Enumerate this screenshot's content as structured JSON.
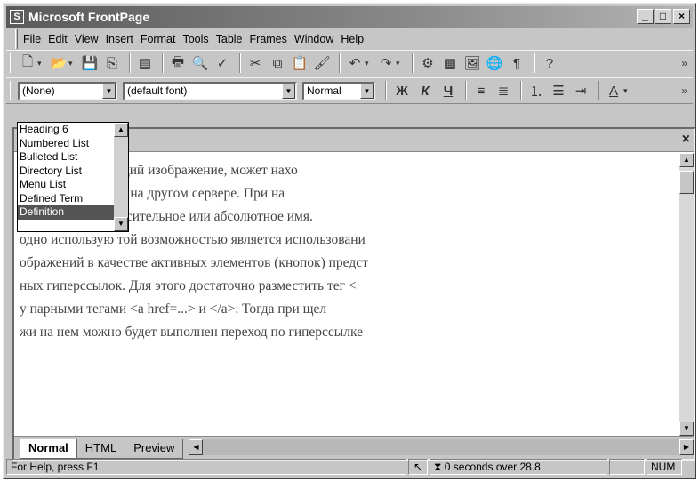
{
  "titlebar": {
    "app_icon": "S",
    "title": "Microsoft FrontPage"
  },
  "menubar": {
    "items": [
      "File",
      "Edit",
      "View",
      "Insert",
      "Format",
      "Tools",
      "Table",
      "Frames",
      "Window",
      "Help"
    ]
  },
  "format_bar": {
    "style_value": "(None)",
    "font_value": "(default font)",
    "size_value": "Normal",
    "bold": "Ж",
    "italic": "К",
    "underline": "Ч"
  },
  "style_dropdown": {
    "options": [
      "Heading 6",
      "Numbered List",
      "Bulleted List",
      "Directory List",
      "Menu List",
      "Defined Term",
      "Definition"
    ],
    "selected_index": 6
  },
  "document": {
    "lines": [
      "е. Файл, содержащий изображение, может нахо",
      "каталоге или даже на другом сервере. При на",
      "ачего полное относительное или абсолютное имя.",
      "одно использую той возможностью является использовани",
      "ображений в качестве активных элементов (кнопок) предст",
      "ных гиперссылок. Для этого достаточно разместить тег <",
      "у парными тегами <a href=...> и </a>. Тогда при щел",
      "жи на нем можно будет выполнен переход по гиперссылке"
    ]
  },
  "view_tabs": [
    "Normal",
    "HTML",
    "Preview"
  ],
  "active_tab": 0,
  "statusbar": {
    "help": "For Help, press F1",
    "timing": "0 seconds over 28.8",
    "num": "NUM"
  }
}
